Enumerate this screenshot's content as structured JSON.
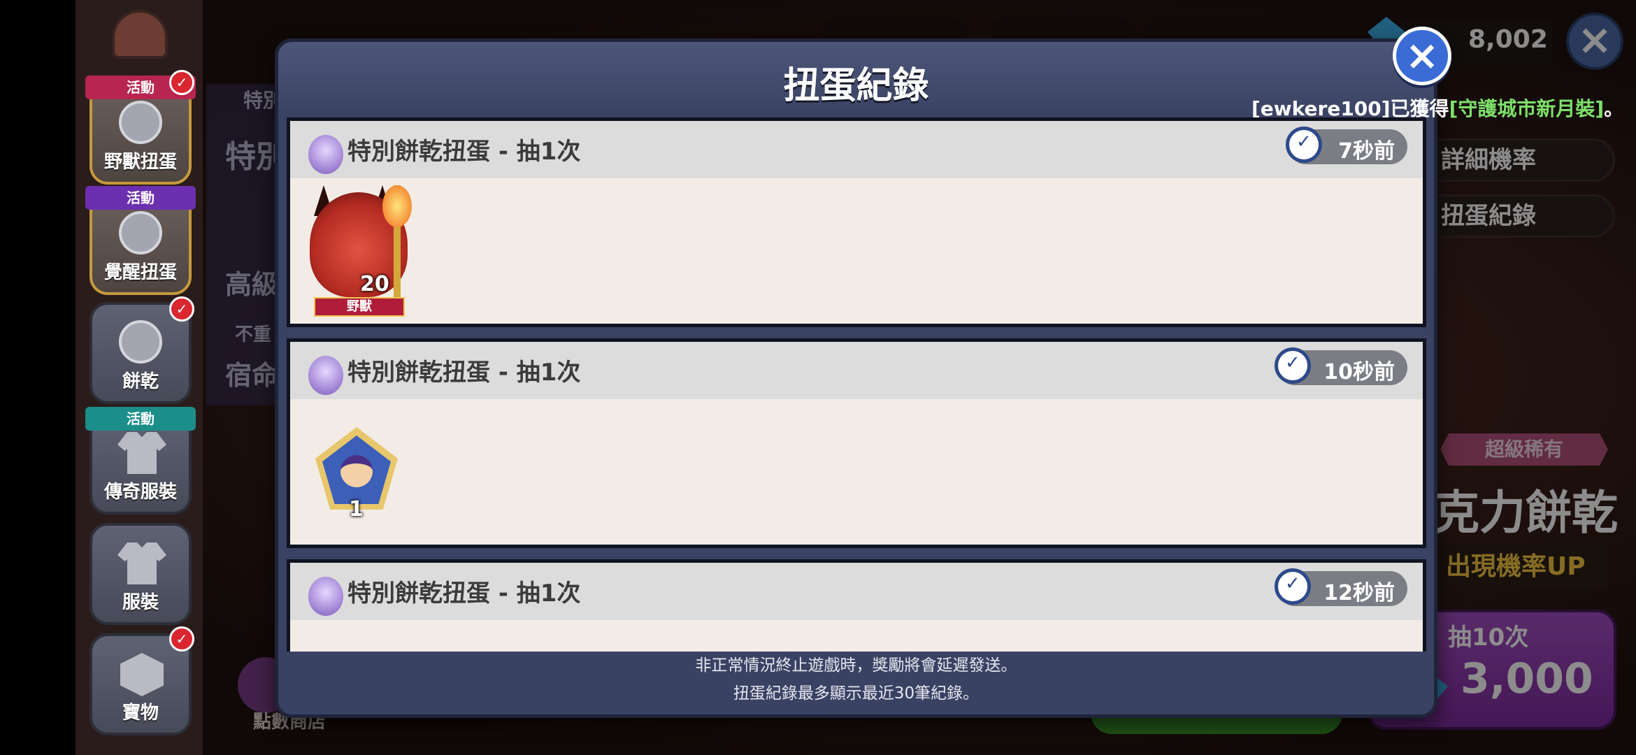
{
  "sidebar": {
    "items": [
      {
        "label": "野獸扭蛋",
        "ribbon": "活動"
      },
      {
        "label": "覺醒扭蛋",
        "ribbon": "活動"
      },
      {
        "label": "餅乾"
      },
      {
        "label": "傳奇服裝",
        "ribbon": "活動"
      },
      {
        "label": "服裝"
      },
      {
        "label": "寶物"
      }
    ]
  },
  "background": {
    "texts": [
      "特別",
      "特別",
      "高級",
      "不重",
      "宿命"
    ],
    "shop_label": "點數商店",
    "right_buttons": [
      "詳細機率",
      "扭蛋紀錄"
    ],
    "rarity": "超級稀有",
    "cookie_name": "克力餅乾",
    "rate_up": "出現機率UP",
    "draw": {
      "label": "抽10次",
      "cost": "3,000"
    }
  },
  "topbar": {
    "gems": "8,002"
  },
  "modal": {
    "title": "扭蛋紀錄",
    "notice_prefix": "[ewkere100]已獲得",
    "notice_item": "[守護城市新月裝]",
    "notice_suffix": "。",
    "records": [
      {
        "title": "特別餅乾扭蛋 - 抽1次",
        "time": "7秒前",
        "reward": {
          "type": "cookie",
          "count": "20",
          "tag": "野獸"
        }
      },
      {
        "title": "特別餅乾扭蛋 - 抽1次",
        "time": "10秒前",
        "reward": {
          "type": "soulstone",
          "count": "1"
        }
      },
      {
        "title": "特別餅乾扭蛋 - 抽1次",
        "time": "12秒前",
        "reward": {
          "type": "unknown"
        }
      }
    ],
    "footer": [
      "非正常情況終止遊戲時，獎勵將會延遲發送。",
      "扭蛋紀錄最多顯示最近30筆紀錄。"
    ]
  },
  "colors": {
    "modal_bg": "#3a4263",
    "notice_highlight": "#7ee06a",
    "record_bg": "#f3ece6",
    "record_header": "#dcdcdc",
    "time_badge": "#7b7d85"
  }
}
